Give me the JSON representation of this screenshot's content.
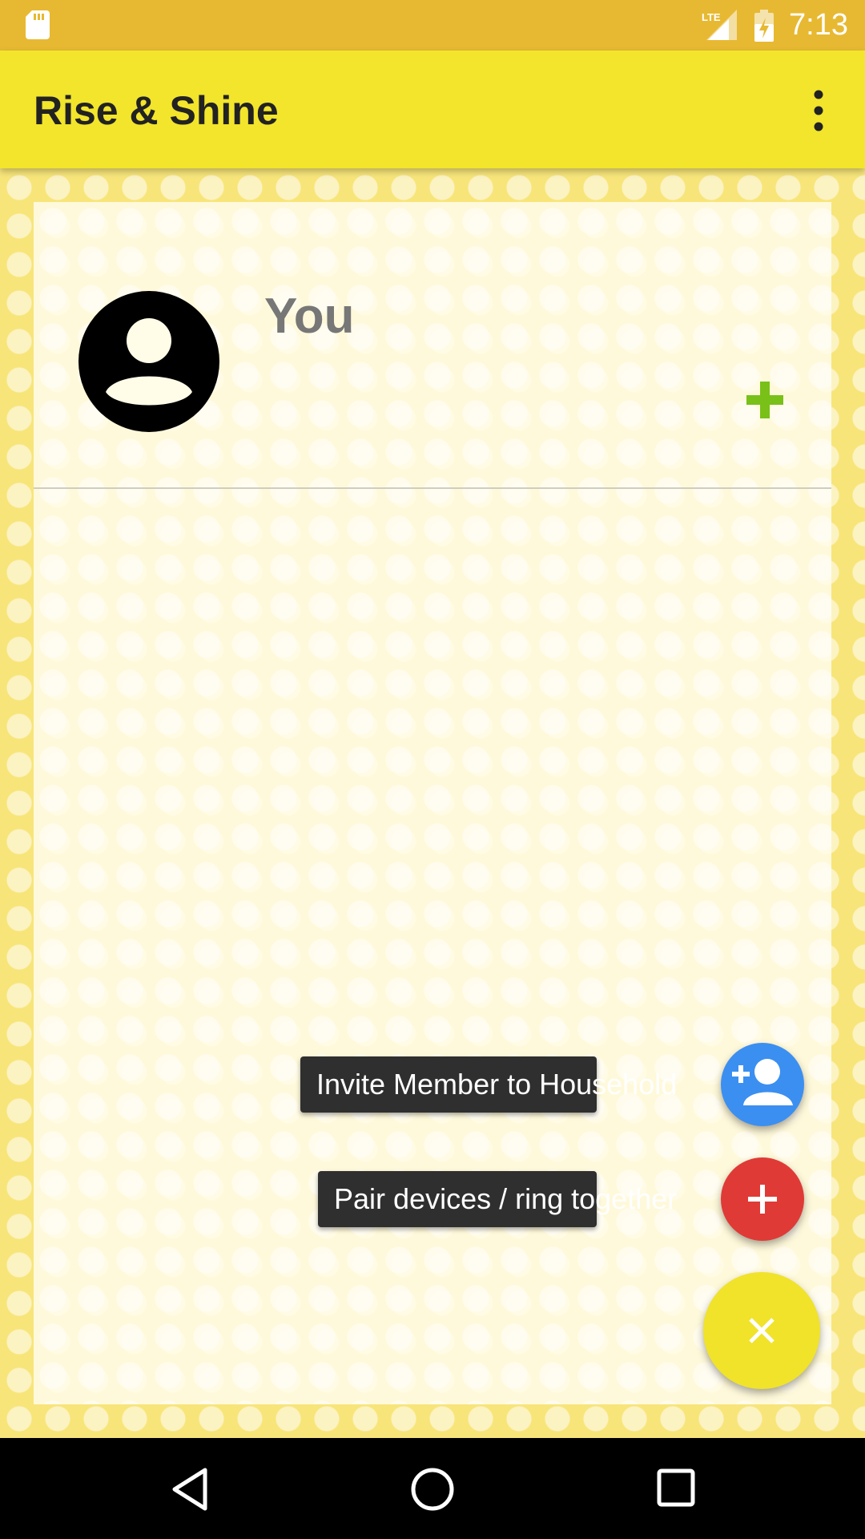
{
  "status_bar": {
    "time": "7:13",
    "network_label": "LTE",
    "icons": [
      "sd-card-icon",
      "lte-signal-icon",
      "battery-charging-icon"
    ]
  },
  "app_bar": {
    "title": "Rise & Shine",
    "menu_icon": "more-vertical-icon"
  },
  "household": {
    "members": [
      {
        "name": "You",
        "avatar_icon": "account-circle-icon",
        "action_icon": "plus-icon"
      }
    ]
  },
  "fab_menu": {
    "items": [
      {
        "label": "Invite Member to Household",
        "icon": "person-add-icon",
        "color": "#3b8ff0"
      },
      {
        "label": "Pair devices / ring together",
        "icon": "plus-icon",
        "color": "#e03a36"
      }
    ],
    "main": {
      "icon": "close-icon",
      "color": "#f0e32a"
    }
  },
  "colors": {
    "status_bar": "#e7b932",
    "app_bar": "#f2e52b",
    "accent_green": "#79c018"
  },
  "nav_bar": {
    "icons": [
      "back-icon",
      "home-icon",
      "recents-icon"
    ]
  }
}
